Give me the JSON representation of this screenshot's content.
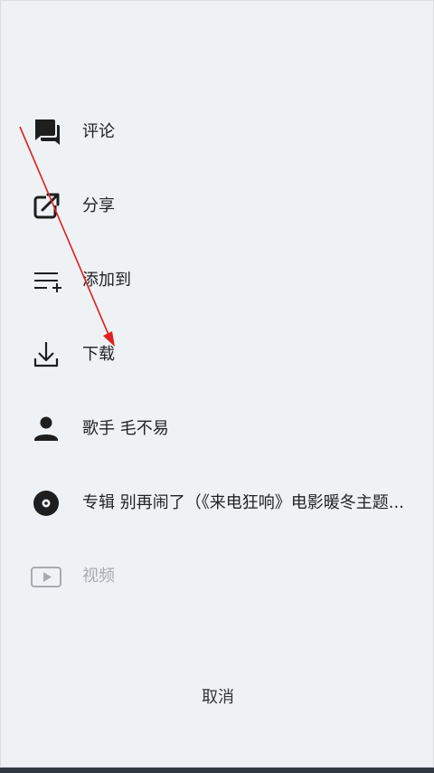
{
  "menu": {
    "comment": "评论",
    "share": "分享",
    "add_to": "添加到",
    "download": "下载",
    "singer": "歌手 毛不易",
    "album": "专辑 别再闹了（《来电狂响》电影暖冬主题...",
    "video": "视频"
  },
  "cancel_label": "取消",
  "colors": {
    "icon": "#1e1e1e",
    "disabled": "#a7abaf",
    "annotation_arrow": "#e02020"
  }
}
